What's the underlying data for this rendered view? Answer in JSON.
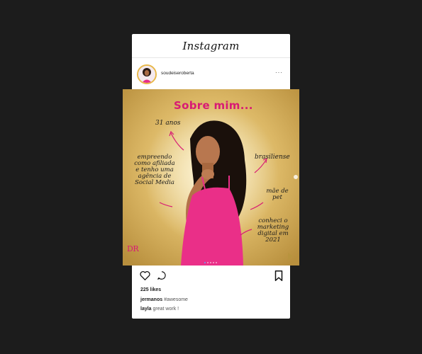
{
  "header": {
    "app_name": "Instagram"
  },
  "profile": {
    "username": "soudeiseroberta",
    "more_label": "···"
  },
  "post": {
    "title": "Sobre mim...",
    "age": "31 anos",
    "left_text": [
      "empreendo",
      "como afiliada",
      "e tenho uma",
      "agência de",
      "Social Media"
    ],
    "brasiliense": "brasiliense",
    "pet": [
      "mãe de",
      "pet"
    ],
    "marketing": [
      "conheci o",
      "marketing",
      "digital em",
      "2021"
    ],
    "brand_mark": "DR",
    "colors": {
      "accent": "#d81b74",
      "gold": "#d8b15a",
      "dress": "#ea2f88"
    }
  },
  "feed": {
    "likes": "225 likes",
    "comments": [
      {
        "user": "jermanos",
        "text": "#awesome"
      },
      {
        "user": "layla",
        "text": "great work !"
      }
    ]
  },
  "icons": [
    "heart-icon",
    "comment-icon",
    "bookmark-icon",
    "next-arrow-icon",
    "more-icon"
  ]
}
